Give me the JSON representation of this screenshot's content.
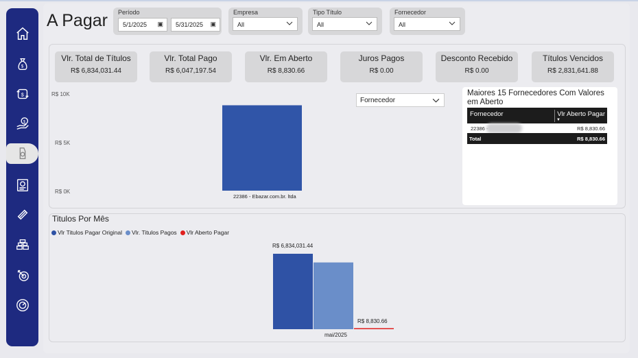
{
  "page": {
    "title": "A Pagar"
  },
  "sidebar": {
    "items": [
      {
        "icon": "home-icon"
      },
      {
        "icon": "money-bag-icon"
      },
      {
        "icon": "cash-cycle-icon"
      },
      {
        "icon": "hand-coin-icon"
      },
      {
        "icon": "payment-icon",
        "active": true
      },
      {
        "icon": "bill-icon"
      },
      {
        "icon": "coin-stack-icon"
      },
      {
        "icon": "cash-pile-icon"
      },
      {
        "icon": "target-icon"
      },
      {
        "icon": "gauge-icon"
      }
    ]
  },
  "filters": {
    "periodo": {
      "label": "Período",
      "start": "5/1/2025",
      "end": "5/31/2025"
    },
    "empresa": {
      "label": "Empresa",
      "value": "All"
    },
    "tipo_titulo": {
      "label": "Tipo Título",
      "value": "All"
    },
    "fornecedor": {
      "label": "Fornecedor",
      "value": "All"
    }
  },
  "kpis": [
    {
      "label": "Vlr. Total de Títulos",
      "value": "R$ 6,834,031.44"
    },
    {
      "label": "Vlr. Total Pago",
      "value": "R$ 6,047,197.54"
    },
    {
      "label": "Vlr. Em Aberto",
      "value": "R$ 8,830.66"
    },
    {
      "label": "Juros Pagos",
      "value": "R$ 0.00"
    },
    {
      "label": "Desconto Recebido",
      "value": "R$ 0.00"
    },
    {
      "label": "Títulos Vencidos",
      "value": "R$ 2,831,641.88"
    }
  ],
  "supplier_dropdown": {
    "value": "Fornecedor"
  },
  "chart_data": [
    {
      "type": "bar",
      "categories": [
        "22386 - Ebazar.com.br. ltda"
      ],
      "values": [
        8830.66
      ],
      "ylim": [
        0,
        10000
      ],
      "yticks": [
        "R$ 10K",
        "R$ 5K",
        "R$ 0K"
      ],
      "ytick_values": [
        10000,
        5000,
        0
      ],
      "colors": [
        "#3055a8"
      ]
    },
    {
      "type": "bar",
      "title": "Titulos Por Mês",
      "categories": [
        "mai/2025"
      ],
      "series": [
        {
          "name": "Vlr Titulos Pagar Original",
          "values": [
            6834031.44
          ],
          "color": "#2f52a5",
          "label": "R$ 6,834,031.44"
        },
        {
          "name": "Vlr. Titulos Pagos",
          "values": [
            6047197.54
          ],
          "color": "#6a8ec9",
          "label": ""
        },
        {
          "name": "Vlr Aberto Pagar",
          "values": [
            8830.66
          ],
          "color": "#e0201f",
          "label": "R$ 8,830.66"
        }
      ],
      "legend": "top-left"
    }
  ],
  "top_suppliers_table": {
    "title": "Maiores 15 Fornecedores Com Valores em Aberto",
    "columns": [
      "Fornecedor",
      "Vlr Aberto Pagar"
    ],
    "rows": [
      {
        "fornecedor": "22386 -",
        "valor": "R$ 8,830.66"
      }
    ],
    "total": {
      "label": "Total",
      "valor": "R$ 8,830.66"
    }
  },
  "colors": {
    "sidebar": "#1e2a80",
    "bar_primary": "#2f52a5",
    "bar_secondary": "#6a8ec9",
    "bar_open": "#e0201f"
  }
}
